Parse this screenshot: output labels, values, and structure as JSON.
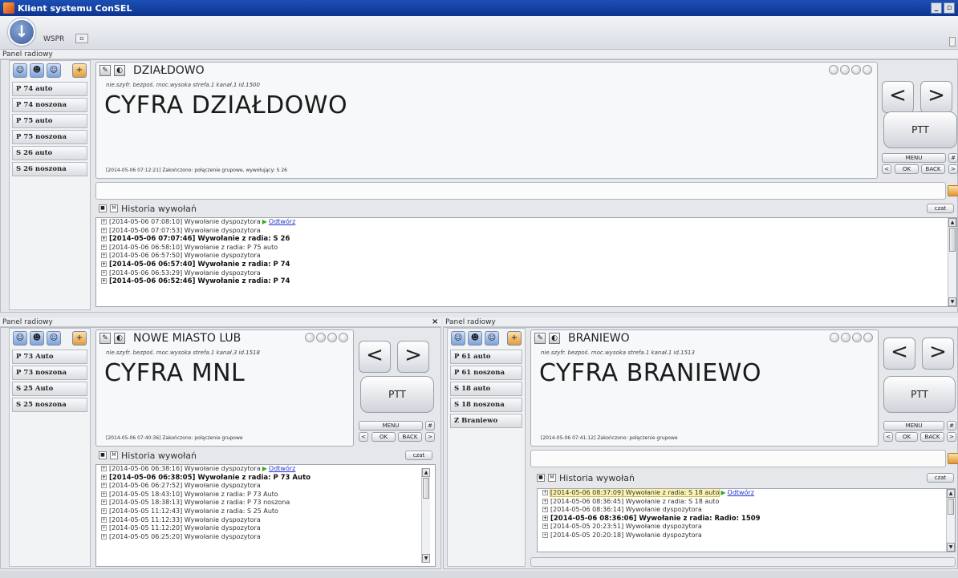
{
  "app": {
    "title": "Klient systemu ConSEL",
    "window_controls": [
      "_",
      "▫"
    ]
  },
  "toolbar": {
    "wspr_label": "WSPR"
  },
  "common": {
    "panel_label": "Panel radiowy",
    "history_title": "Historia wywołań",
    "czat_label": "czat",
    "menu_label": "MENU",
    "hash_label": "#",
    "ok_label": "OK",
    "back_label": "BACK",
    "ptt_label": "PTT",
    "prev_label": "<",
    "next_label": ">",
    "play_label": "Odtwórz",
    "close_label": "×"
  },
  "panels": [
    {
      "name": "DZIAŁDOWO",
      "meta": "nie.szyfr. bezpoś. moc.wysoka strefa.1 kanał.1 id.1500",
      "big_label": "CYFRA DZIAŁDOWO",
      "status": "[2014-05-06 07:12:21] Zakończono: połączenie grupowe, wywołujący: S 26",
      "units": [
        "P 74 auto",
        "P 74 noszona",
        "P 75 auto",
        "P 75 noszona",
        "S 26 auto",
        "S 26 noszona"
      ],
      "history": [
        {
          "text": "[2014-05-06 07:08:10] Wywołanie dyspozytora",
          "bold": false,
          "play": true
        },
        {
          "text": "[2014-05-06 07:07:53] Wywołanie dyspozytora",
          "bold": false
        },
        {
          "text": "[2014-05-06 07:07:46] Wywołanie z radia: S 26",
          "bold": true
        },
        {
          "text": "[2014-05-06 06:58:10] Wywołanie z radia: P 75 auto",
          "bold": false
        },
        {
          "text": "[2014-05-06 06:57:50] Wywołanie dyspozytora",
          "bold": false
        },
        {
          "text": "[2014-05-06 06:57:40] Wywołanie z radia: P 74",
          "bold": true
        },
        {
          "text": "[2014-05-06 06:53:29] Wywołanie dyspozytora",
          "bold": false
        },
        {
          "text": "[2014-05-06 06:52:46] Wywołanie z radia: P 74",
          "bold": true
        }
      ]
    },
    {
      "name": "NOWE MIASTO LUB",
      "meta": "nie.szyfr. bezpoś. moc.wysoka strefa.1 kanał.3 id.1518",
      "big_label": "CYFRA MNL",
      "status": "[2014-05-06 07:40:36] Zakończono: połączenie grupowe",
      "units": [
        "P 73 Auto",
        "P 73 noszona",
        "S 25 Auto",
        "S 25 noszona"
      ],
      "history": [
        {
          "text": "[2014-05-06 06:38:16] Wywołanie dyspozytora",
          "bold": false,
          "play": true
        },
        {
          "text": "[2014-05-06 06:38:05] Wywołanie z radia: P 73 Auto",
          "bold": true
        },
        {
          "text": "[2014-05-06 06:27:52] Wywołanie dyspozytora",
          "bold": false
        },
        {
          "text": "[2014-05-05 18:43:10] Wywołanie z radia: P 73 Auto",
          "bold": false
        },
        {
          "text": "[2014-05-05 18:38:13] Wywołanie z radia: P 73 noszona",
          "bold": false
        },
        {
          "text": "[2014-05-05 11:12:43] Wywołanie z radia: S 25 Auto",
          "bold": false
        },
        {
          "text": "[2014-05-05 11:12:33] Wywołanie dyspozytora",
          "bold": false
        },
        {
          "text": "[2014-05-05 11:12:20] Wywołanie dyspozytora",
          "bold": false
        },
        {
          "text": "[2014-05-05 06:25:20] Wywołanie dyspozytora",
          "bold": false
        }
      ]
    },
    {
      "name": "BRANIEWO",
      "meta": "nie.szyfr. bezpoś. moc.wysoka strefa.1 kanał.1 id.1513",
      "big_label": "CYFRA BRANIEWO",
      "status": "[2014-05-06 07:41:12] Zakończono: połączenie grupowe",
      "units": [
        "P 61 auto",
        "P 61 noszona",
        "S 18 auto",
        "S 18 noszona",
        "Z Braniewo"
      ],
      "history": [
        {
          "text": "[2014-05-06 08:37:09] Wywołanie z radia: S 18 auto",
          "bold": false,
          "play": true,
          "highlight": true
        },
        {
          "text": "[2014-05-06 08:36:45] Wywołanie z radia: S 18 auto",
          "bold": false
        },
        {
          "text": "[2014-05-06 08:36:14] Wywołanie dyspozytora",
          "bold": false
        },
        {
          "text": "[2014-05-06 08:36:06] Wywołanie z radia: Radio: 1509",
          "bold": true
        },
        {
          "text": "[2014-05-05 20:23:51] Wywołanie dyspozytora",
          "bold": false
        },
        {
          "text": "[2014-05-05 20:20:18] Wywołanie dyspozytora",
          "bold": false
        }
      ]
    }
  ]
}
